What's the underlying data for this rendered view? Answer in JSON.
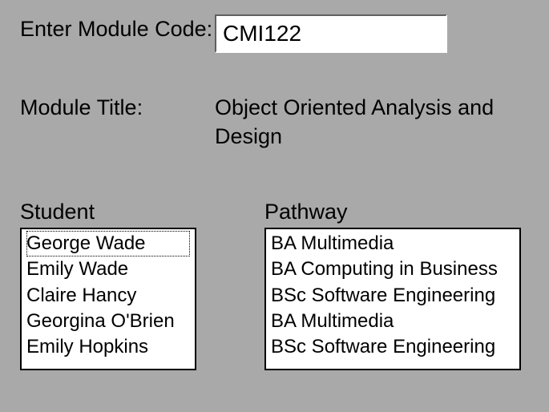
{
  "form": {
    "module_code_label": "Enter Module Code:",
    "module_code_value": "CMI122",
    "module_title_label": "Module Title:",
    "module_title_value": "Object Oriented Analysis and Design"
  },
  "students": {
    "header": "Student",
    "items": [
      "George Wade",
      "Emily Wade",
      "Claire Hancy",
      "Georgina O'Brien",
      "Emily Hopkins"
    ]
  },
  "pathways": {
    "header": "Pathway",
    "items": [
      "BA Multimedia",
      "BA Computing in Business",
      "BSc Software Engineering",
      "BA Multimedia",
      "BSc Software Engineering"
    ]
  }
}
